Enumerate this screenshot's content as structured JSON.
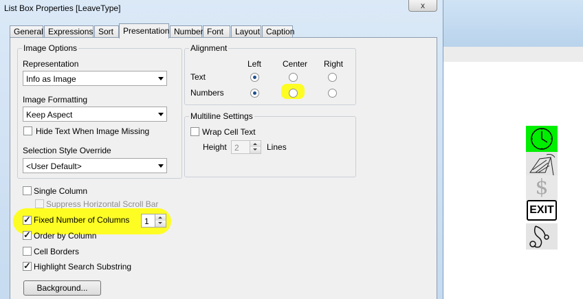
{
  "window": {
    "title": "List Box Properties [LeaveType]",
    "close_label": "x"
  },
  "tabs": [
    {
      "label": "General"
    },
    {
      "label": "Expressions"
    },
    {
      "label": "Sort"
    },
    {
      "label": "Presentation",
      "active": true
    },
    {
      "label": "Number"
    },
    {
      "label": "Font"
    },
    {
      "label": "Layout"
    },
    {
      "label": "Caption"
    }
  ],
  "image_options": {
    "group_label": "Image Options",
    "representation_label": "Representation",
    "representation_value": "Info as Image",
    "formatting_label": "Image Formatting",
    "formatting_value": "Keep Aspect",
    "hide_text_label": "Hide Text When Image Missing",
    "hide_text_checked": false,
    "selection_style_label": "Selection Style Override",
    "selection_style_value": "<User Default>"
  },
  "alignment": {
    "group_label": "Alignment",
    "columns": [
      "Left",
      "Center",
      "Right"
    ],
    "rows": [
      {
        "label": "Text",
        "selected": "Left"
      },
      {
        "label": "Numbers",
        "selected": "Left"
      }
    ]
  },
  "multiline": {
    "group_label": "Multiline Settings",
    "wrap_label": "Wrap Cell Text",
    "wrap_checked": false,
    "height_label": "Height",
    "height_value": "2",
    "lines_label": "Lines"
  },
  "options": {
    "single_column": "Single Column",
    "suppress_scroll": "Suppress Horizontal Scroll Bar",
    "fixed_columns": "Fixed Number of Columns",
    "fixed_columns_value": "1",
    "order_by_column": "Order by Column",
    "cell_borders": "Cell Borders",
    "highlight_search": "Highlight Search Substring",
    "background_button": "Background..."
  },
  "background_app": {
    "icons": [
      "clock-icon",
      "beach-chair-icon",
      "dollar-icon",
      "exit-sign-icon",
      "stethoscope-icon"
    ],
    "exit_label": "EXIT",
    "dollar_label": "$",
    "clock_bg": "#00ee00"
  },
  "colors": {
    "highlight": "#ffff00",
    "accent": "#1e4f8f"
  }
}
